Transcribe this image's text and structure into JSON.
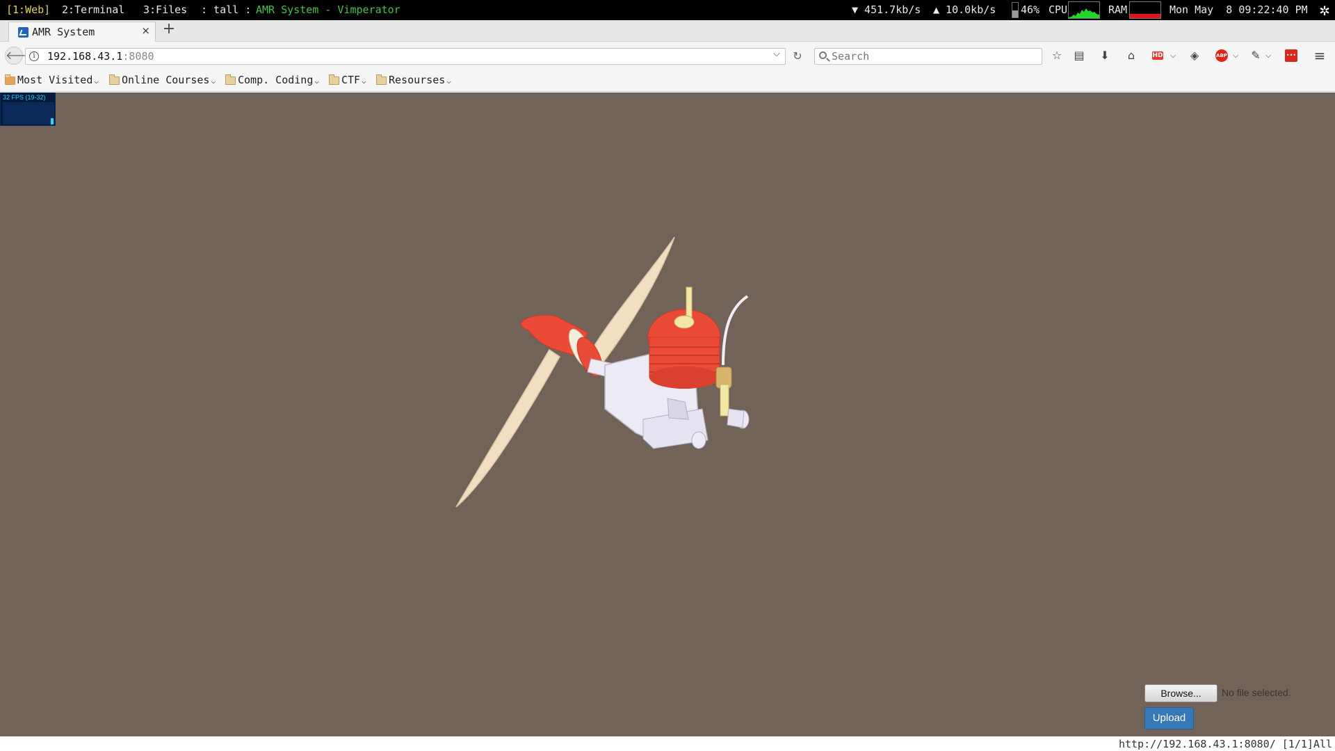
{
  "wm": {
    "workspace_1": "[1:Web]",
    "workspace_2": "2:Terminal",
    "workspace_3": "3:Files",
    "layout": ": tall :",
    "window_title": "AMR System - Vimperator",
    "net_down": "▼ 451.7kb/s",
    "net_up": "▲ 10.0kb/s",
    "battery_level": 0.46,
    "cpu_percent": "46%",
    "cpu_label": "CPU",
    "ram_label": "RAM",
    "ram_usage": 0.25,
    "clock": "Mon May  8 09:22:40 PM",
    "colors": {
      "active_workspace": "#e6d24a",
      "title": "#43c24b",
      "cpu_graph": "#22d62c",
      "ram_graph": "#e1141b"
    }
  },
  "tab": {
    "title": "AMR System",
    "close_glyph": "×",
    "new_tab_glyph": "+"
  },
  "nav": {
    "url_host": "192.168.43.1",
    "url_port": ":8080",
    "search_placeholder": "Search",
    "icons": [
      "back-icon",
      "info-icon",
      "reload-icon",
      "bookmark-star-icon",
      "reader-list-icon",
      "download-icon",
      "home-icon",
      "hd-extension-icon",
      "pocket-icon",
      "adblock-plus-icon",
      "extension-icon",
      "red-extension-icon",
      "menu-icon"
    ]
  },
  "bookmarks": [
    {
      "label": "Most Visited"
    },
    {
      "label": "Online Courses"
    },
    {
      "label": "Comp. Coding"
    },
    {
      "label": "CTF"
    },
    {
      "label": "Resourses"
    }
  ],
  "viewport": {
    "background": "#726359",
    "fps_label": "32 FPS (19-32)",
    "model_colors": {
      "propeller": "#f2dfc2",
      "spinner": "#ea4a36",
      "cylinder_head": "#ea4a36",
      "crankcase": "#eceaf4",
      "carb": "#d8b56a"
    }
  },
  "upload_form": {
    "browse_label": "Browse...",
    "file_status": "No file selected.",
    "upload_label": "Upload"
  },
  "statusline": {
    "text": "http://192.168.43.1:8080/ [1/1]All"
  }
}
